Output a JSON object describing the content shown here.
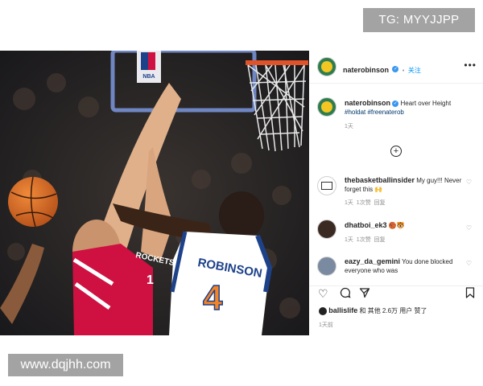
{
  "watermark_top": "TG: MYYJJPP",
  "watermark_bottom": "www.dqjhh.com",
  "post": {
    "username": "naterobinson",
    "follow_label": "关注",
    "more_icon": "more-icon",
    "caption": {
      "username": "naterobinson",
      "text": "Heart over Height",
      "hashtags": "#holdat #freenaterob",
      "time": "1天"
    },
    "load_more_icon": "plus-circle-icon",
    "comments": [
      {
        "username": "thebasketballinsider",
        "text": "My guy!!! Never forget this 🙌",
        "time": "1天",
        "likes": "1次赞",
        "reply": "回复"
      },
      {
        "username": "dhatboi_ek3",
        "text": "🏀🐯",
        "time": "1天",
        "likes": "1次赞",
        "reply": "回复"
      },
      {
        "username": "eazy_da_gemini",
        "text": "You done blocked everyone who was"
      }
    ],
    "likes_user": "ballislife",
    "likes_text": "和 其他 2.6万 用户 赞了",
    "date": "1天前"
  },
  "photo": {
    "jersey_name": "ROBINSON",
    "jersey_number": "4",
    "opponent_jersey": "ROCKETS",
    "opponent_number": "1",
    "backboard_logo": "NBA"
  },
  "colors": {
    "follow": "#0095f6",
    "verified": "#3897f0",
    "knicks_orange": "#f58426",
    "knicks_blue": "#1d428a",
    "rockets_red": "#ce1141"
  }
}
